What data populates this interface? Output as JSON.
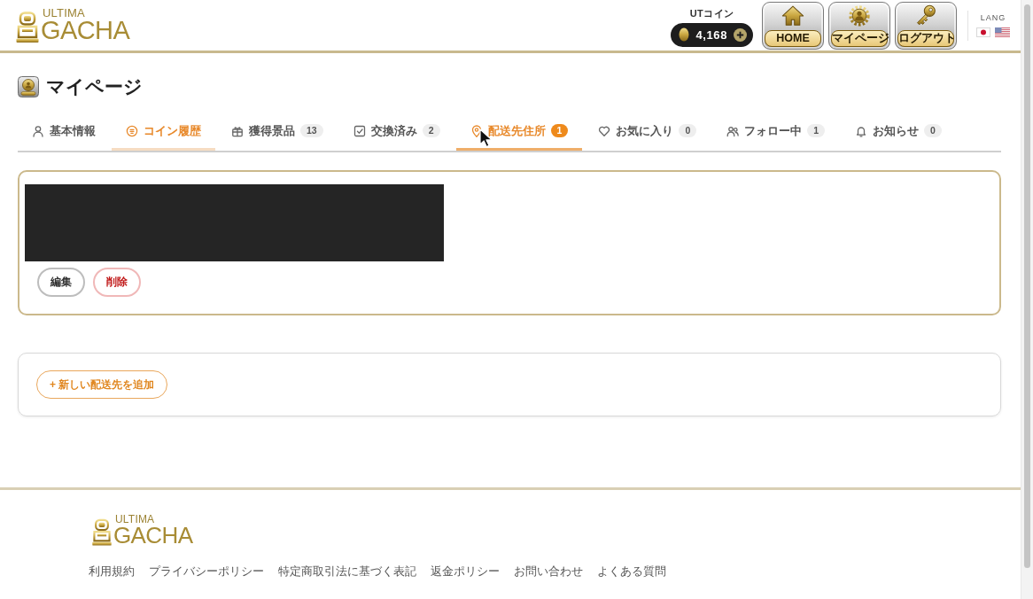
{
  "header": {
    "logo": {
      "line1": "ULTIMA",
      "line2": "GACHA"
    },
    "coin": {
      "label": "UTコイン",
      "amount": "4,168"
    },
    "nav_buttons": [
      {
        "kind": "home",
        "label": "HOME"
      },
      {
        "kind": "mypage",
        "label": "マイページ"
      },
      {
        "kind": "logout",
        "label": "ログアウト"
      }
    ],
    "lang": {
      "label": "LANG",
      "flags": [
        {
          "kind": "jp"
        },
        {
          "kind": "us"
        }
      ]
    }
  },
  "page_title": "マイページ",
  "tabs": [
    {
      "kind": "profile",
      "label": "基本情報",
      "selected": false,
      "highlighted": false
    },
    {
      "kind": "coins",
      "label": "コイン履歴",
      "selected": false,
      "highlighted": true
    },
    {
      "kind": "prizes",
      "label": "獲得景品",
      "badge": "13",
      "selected": false,
      "highlighted": false
    },
    {
      "kind": "exchanged",
      "label": "交換済み",
      "badge": "2",
      "selected": false,
      "highlighted": false
    },
    {
      "kind": "address",
      "label": "配送先住所",
      "badge": "1",
      "selected": true,
      "highlighted": false
    },
    {
      "kind": "favorites",
      "label": "お気に入り",
      "badge": "0",
      "selected": false,
      "highlighted": false
    },
    {
      "kind": "following",
      "label": "フォロー中",
      "badge": "1",
      "selected": false,
      "highlighted": false
    },
    {
      "kind": "notices",
      "label": "お知らせ",
      "badge": "0",
      "selected": false,
      "highlighted": false
    }
  ],
  "addresses": [
    {
      "redacted": true,
      "buttons": [
        {
          "kind": "edit",
          "label": "編集"
        },
        {
          "kind": "delete",
          "label": "削除"
        }
      ]
    }
  ],
  "add_button": {
    "label": "+ 新しい配送先を追加"
  },
  "footer": {
    "logo": {
      "line1": "ULTIMA",
      "line2": "GACHA"
    },
    "links": [
      "利用規約",
      "プライバシーポリシー",
      "特定商取引法に基づく表記",
      "返金ポリシー",
      "お問い合わせ",
      "よくある質問"
    ]
  }
}
